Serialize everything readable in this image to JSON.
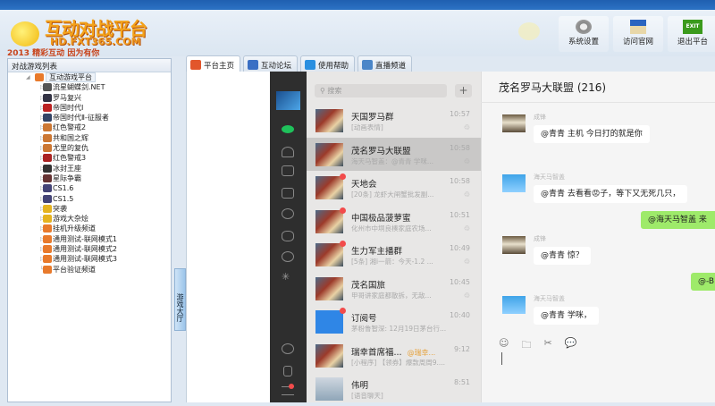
{
  "header": {
    "logo_title": "互动对战平台",
    "logo_url": "HD.FXT365.COM",
    "logo_slogan": "2013 精彩互动 因为有你",
    "buttons": [
      {
        "label": "系统设置",
        "icon": "gear-icon"
      },
      {
        "label": "访问官网",
        "icon": "house-icon"
      },
      {
        "label": "退出平台",
        "icon": "exit-icon",
        "icon_text": "EXIT"
      }
    ]
  },
  "left_panel": {
    "title": "对战游戏列表",
    "root": "互动游戏平台",
    "games": [
      "流星蝴蝶剑.NET",
      "罗马复兴",
      "帝国时代Ⅰ",
      "帝国时代Ⅱ-征服者",
      "红色警戒2",
      "共和国之辉",
      "尤里的复仇",
      "红色警戒3",
      "冰封王座",
      "星际争霸",
      "CS1.6",
      "CS1.5",
      "突袭",
      "游戏大杂烩",
      "挂机升级频道",
      "通用测试-联网模式1",
      "通用测试-联网模式2",
      "通用测试-联网模式3",
      "平台验证频道"
    ]
  },
  "side_tab": "游戏大厅",
  "tabs": [
    {
      "label": "平台主页",
      "color": "#e2562b"
    },
    {
      "label": "互动论坛",
      "color": "#3a6fc4"
    },
    {
      "label": "使用帮助",
      "color": "#2a8fe0"
    },
    {
      "label": "直播频道",
      "color": "#4b86c8"
    }
  ],
  "chat_list": {
    "search_placeholder": "搜索",
    "add": "+",
    "items": [
      {
        "name": "天国罗马群",
        "time": "10:57",
        "preview": "[动画表情]",
        "unread": false
      },
      {
        "name": "茂名罗马大联盟",
        "time": "10:58",
        "preview": "海天马智盖：@青青 学咪...",
        "unread": false,
        "selected": true
      },
      {
        "name": "天地会",
        "time": "10:58",
        "preview": "[20条] 龙虾大闸蟹批发副...",
        "unread": true
      },
      {
        "name": "中国极品菠萝蜜",
        "time": "10:51",
        "preview": "化州市中垌良楱家庭农场...",
        "unread": true
      },
      {
        "name": "生力军主播群",
        "time": "10:49",
        "preview": "[5条] 湘i一箭：今天-1.2 ...",
        "unread": true
      },
      {
        "name": "茂名国旅",
        "time": "10:45",
        "preview": "甲哥讲家庭都散拆，无敌...",
        "unread": false
      },
      {
        "name": "订阅号",
        "time": "10:40",
        "preview": "茅粉鲁智深: 12月19日茅台行...",
        "unread": true
      },
      {
        "name": "瑞幸首席福...",
        "mention": "@瑞幸...",
        "time": "9:12",
        "preview": "[小程序] 【领券】爆款周周9....",
        "unread": false
      },
      {
        "name": "伟明",
        "time": "8:51",
        "preview": "[语音聊天]",
        "unread": false
      }
    ]
  },
  "chat": {
    "title": "茂名罗马大联盟 (216)",
    "messages": [
      {
        "sender": "成锋",
        "text": "@青青 主机 今日打的就是你",
        "side": "left"
      },
      {
        "sender": "海天马智盖",
        "text": "@青青 去看看😡子，等下又无死几只，",
        "side": "left"
      },
      {
        "sender": "",
        "text": "@海天马智盖 来",
        "side": "right"
      },
      {
        "sender": "成锋",
        "text": "@青青 惊？",
        "side": "left"
      },
      {
        "sender": "",
        "text": "@-B",
        "side": "right"
      },
      {
        "sender": "海天马智盖",
        "text": "@青青 学咪，",
        "side": "left"
      }
    ],
    "tools": [
      "☺",
      "🗀",
      "✂",
      "💬"
    ]
  }
}
